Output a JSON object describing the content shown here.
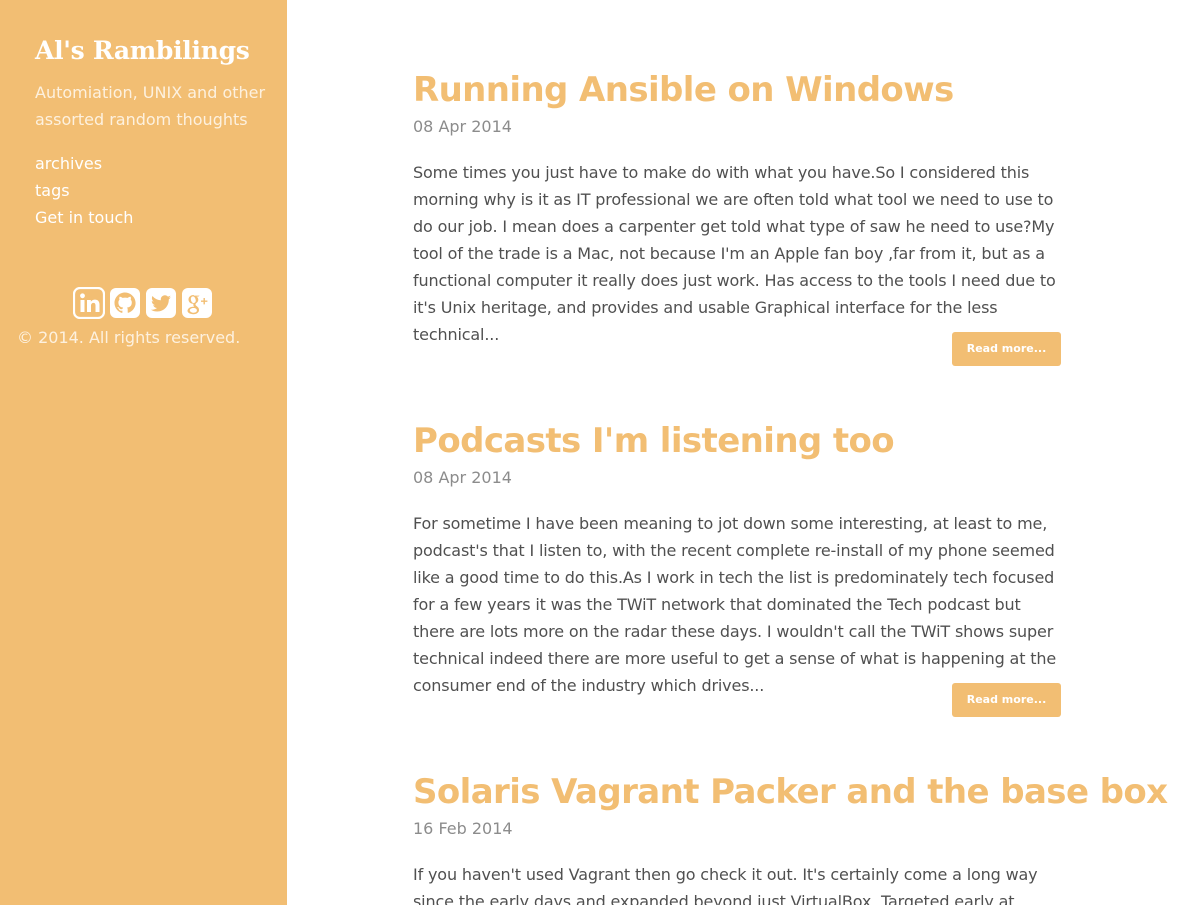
{
  "sidebar": {
    "title": "Al's Rambilings",
    "tagline": "Automiation, UNIX and other assorted random thoughts",
    "nav": [
      {
        "label": "archives"
      },
      {
        "label": "tags"
      },
      {
        "label": "Get in touch"
      }
    ],
    "social": [
      "linkedin-icon",
      "github-icon",
      "twitter-icon",
      "google-plus-icon"
    ],
    "copyright": "© 2014. All rights reserved."
  },
  "posts": [
    {
      "title": "Running Ansible on Windows",
      "date": "08 Apr 2014",
      "excerpt": "Some times you just have to make do with what you have.So I considered this morning why is it as IT professional we are often told what tool we need to use to do our job. I mean does a carpenter get told what type of saw he need to use?My tool of the trade is a Mac, not because I'm an Apple fan boy ,far from it, but as a functional computer it really does just work. Has access to the tools I need due to it's Unix heritage, and provides and usable Graphical interface for the less technical...",
      "read_more": "Read more..."
    },
    {
      "title": "Podcasts I'm listening too",
      "date": "08 Apr 2014",
      "excerpt": "For sometime I have been meaning to jot down some interesting, at least to me, podcast's that I listen to, with the recent complete re-install of my phone seemed like a good time to do this.As I work in tech the list is predominately tech focused for a few years it was the TWiT network that dominated the Tech podcast but there are lots more on the radar these days. I wouldn't call the TWiT shows super technical indeed there are more useful to get a sense of what is happening at the consumer end of the industry which drives...",
      "read_more": "Read more..."
    },
    {
      "title": "Solaris Vagrant Packer and the base box",
      "date": "16 Feb 2014",
      "excerpt": "If you haven't used Vagrant then go check it out. It's certainly come a long way since the early days and expanded beyond just VirtualBox. Targeted early at"
    }
  ],
  "colors": {
    "accent": "#f2be73",
    "sidebar_bg": "#f2be73",
    "body_text": "#505050",
    "date_text": "#8c8c8c"
  }
}
